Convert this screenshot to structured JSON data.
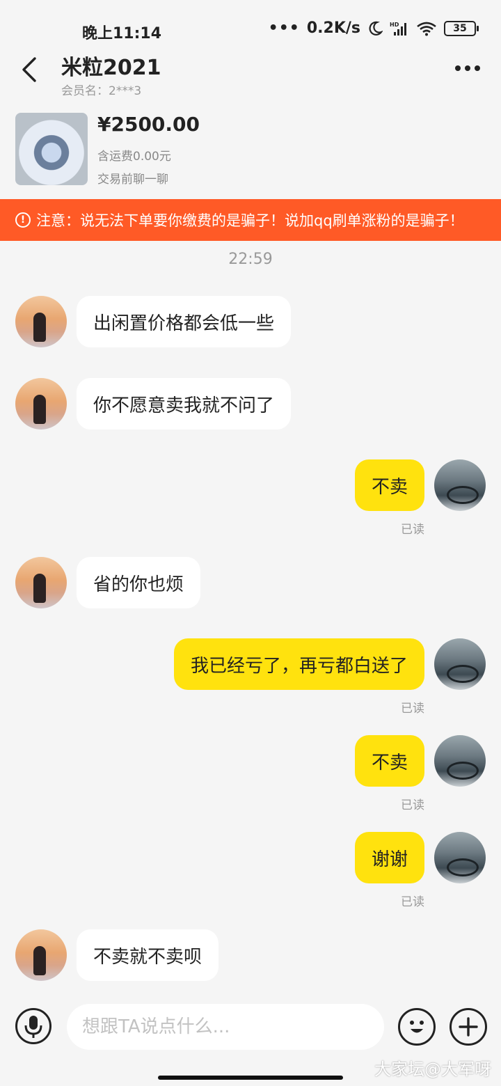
{
  "status_bar": {
    "time": "晚上11:14",
    "network_speed": "0.2K/s",
    "network_type": "HD",
    "battery": "35",
    "icons": [
      "moon-icon",
      "signal-icon",
      "wifi-icon",
      "battery-icon"
    ]
  },
  "header": {
    "title": "米粒2021",
    "member_label": "会员名：2***3"
  },
  "product": {
    "price": "¥2500.00",
    "shipping": "含运费0.00元",
    "note": "交易前聊一聊"
  },
  "warning": {
    "text": "注意：说无法下单要你缴费的是骗子！说加qq刷单涨粉的是骗子！"
  },
  "chat": {
    "time_separator": "22:59",
    "messages": [
      {
        "from": "them",
        "text": "出闲置价格都会低一些"
      },
      {
        "from": "them",
        "text": "你不愿意卖我就不问了"
      },
      {
        "from": "me",
        "text": "不卖",
        "status": "已读"
      },
      {
        "from": "them",
        "text": "省的你也烦"
      },
      {
        "from": "me",
        "text": "我已经亏了，再亏都白送了",
        "status": "已读"
      },
      {
        "from": "me",
        "text": "不卖",
        "status": "已读"
      },
      {
        "from": "me",
        "text": "谢谢",
        "status": "已读"
      },
      {
        "from": "them",
        "text": "不卖就不卖呗"
      }
    ]
  },
  "input": {
    "placeholder": "想跟TA说点什么..."
  },
  "watermark": "大家坛@大军呀",
  "colors": {
    "accent_yellow": "#ffe20e",
    "warning_orange": "#ff5a26",
    "background": "#f5f5f5"
  }
}
